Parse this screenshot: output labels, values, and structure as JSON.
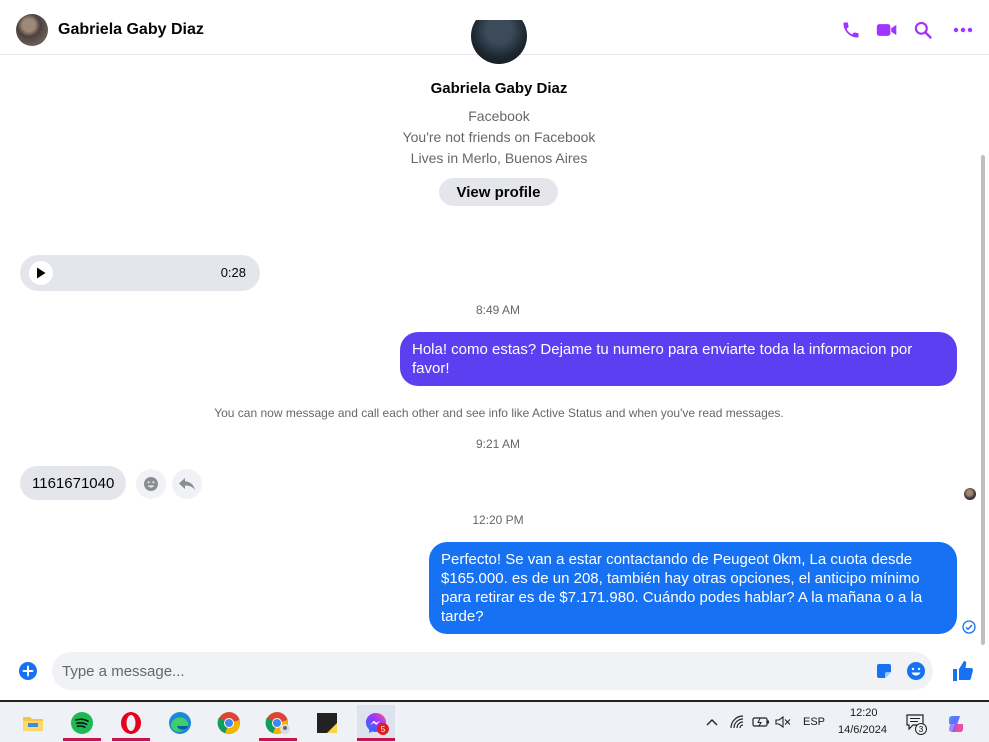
{
  "header": {
    "contact_name": "Gabriela Gaby Diaz",
    "icons": [
      "phone-icon",
      "video-icon",
      "search-icon",
      "more-icon"
    ],
    "accent_color": "#a033ff"
  },
  "profile": {
    "name": "Gabriela Gaby Diaz",
    "platform": "Facebook",
    "friend_status": "You're not friends on Facebook",
    "location": "Lives in Merlo, Buenos Aires",
    "view_profile_label": "View profile"
  },
  "messages": {
    "audio_duration": "0:28",
    "time_1": "8:49 AM",
    "out_1": "Hola! como estas? Dejame tu numero para enviarte toda la informacion por favor!",
    "system_notice": "You can now message and call each other and see info like Active Status and when you've read messages.",
    "time_2": "9:21 AM",
    "in_1": "1161671040",
    "time_3": "12:20 PM",
    "out_2": "Perfecto!  Se van a estar contactando de Peugeot 0km, La cuota desde $165.000. es de un 208, también hay otras opciones, el anticipo mínimo para retirar es de $7.171.980. Cuándo podes hablar? A la mañana o a la tarde?",
    "out_1_color": "#5b3ff0",
    "out_2_color": "#1672f3"
  },
  "composer": {
    "placeholder": "Type a message..."
  },
  "taskbar": {
    "apps": [
      "file-explorer-icon",
      "spotify-icon",
      "opera-icon",
      "edge-icon",
      "chrome-icon",
      "chrome-profile-icon",
      "sticky-notes-icon",
      "messenger-icon"
    ],
    "messenger_badge": "5",
    "language": "ESP",
    "time": "12:20",
    "date": "14/6/2024",
    "notification_count": "3"
  }
}
